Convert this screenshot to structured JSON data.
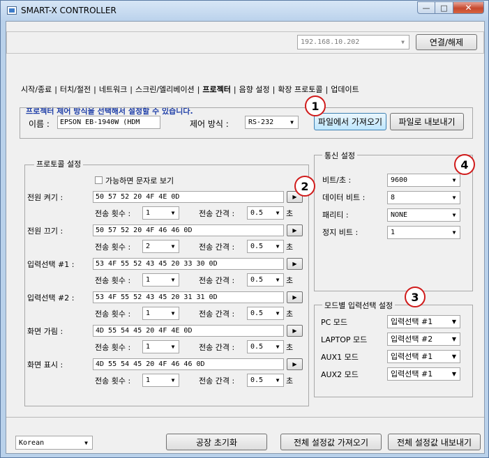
{
  "window": {
    "title": "SMART-X CONTROLLER"
  },
  "connection": {
    "ip": "192.168.10.202",
    "connect_button": "연결/해제"
  },
  "tabs": [
    "시작/종료",
    "터치/절전",
    "네트워크",
    "스크린/엘리베이션",
    "프로젝터",
    "음향 설정",
    "확장 프로토콜",
    "업데이트"
  ],
  "active_tab": "프로젝터",
  "info_text": "프로젝터 제어 방식을 선택해서 설정할 수 있습니다.",
  "device": {
    "name_label": "이름 :",
    "name_value": "EPSON EB-1940W (HDM",
    "control_label": "제어 방식 :",
    "control_value": "RS-232",
    "import_button": "파일에서 가져오기",
    "export_button": "파일로 내보내기"
  },
  "protocol": {
    "title": "프로토콜 설정",
    "text_checkbox": "가능하면 문자로 보기",
    "count_label": "전송 횟수 :",
    "interval_label": "전송 간격 :",
    "sec_unit": "초",
    "play_icon": "▶",
    "rows": [
      {
        "label": "전원 켜기 :",
        "hex": "50 57 52 20 4F 4E 0D",
        "count": "1",
        "interval": "0.5"
      },
      {
        "label": "전원 끄기 :",
        "hex": "50 57 52 20 4F 46 46 0D",
        "count": "2",
        "interval": "0.5"
      },
      {
        "label": "입력선택 #1 :",
        "hex": "53 4F 55 52 43 45 20 33 30 0D",
        "count": "1",
        "interval": "0.5"
      },
      {
        "label": "입력선택 #2 :",
        "hex": "53 4F 55 52 43 45 20 31 31 0D",
        "count": "1",
        "interval": "0.5"
      },
      {
        "label": "화면 가림 :",
        "hex": "4D 55 54 45 20 4F 4E 0D",
        "count": "1",
        "interval": "0.5"
      },
      {
        "label": "화면 표시 :",
        "hex": "4D 55 54 45 20 4F 46 46 0D",
        "count": "1",
        "interval": "0.5"
      }
    ]
  },
  "comm": {
    "title": "통신 설정",
    "rows": [
      {
        "label": "비트/초 :",
        "value": "9600"
      },
      {
        "label": "데이터 비트 :",
        "value": "8"
      },
      {
        "label": "패리티 :",
        "value": "NONE"
      },
      {
        "label": "정지 비트 :",
        "value": "1"
      }
    ]
  },
  "mode": {
    "title": "모드별 입력선택 설정",
    "rows": [
      {
        "label": "PC 모드",
        "value": "입력선택 #1"
      },
      {
        "label": "LAPTOP 모드",
        "value": "입력선택 #2"
      },
      {
        "label": "AUX1 모드",
        "value": "입력선택 #1"
      },
      {
        "label": "AUX2 모드",
        "value": "입력선택 #1"
      }
    ]
  },
  "callouts": [
    "1",
    "2",
    "3",
    "4"
  ],
  "footer": {
    "language": "Korean",
    "factory_reset": "공장 초기화",
    "import_all": "전체 설정값 가져오기",
    "export_all": "전체 설정값 내보내기"
  },
  "icons": {
    "dropdown": "chevron-down-icon",
    "play": "play-icon",
    "app": "app-window-icon",
    "minimize": "minimize-icon",
    "maximize": "maximize-icon",
    "close": "close-icon"
  },
  "colors": {
    "info_text": "#1f3fa8",
    "callout_border": "#d01a1a",
    "close_button": "#c6492f"
  }
}
